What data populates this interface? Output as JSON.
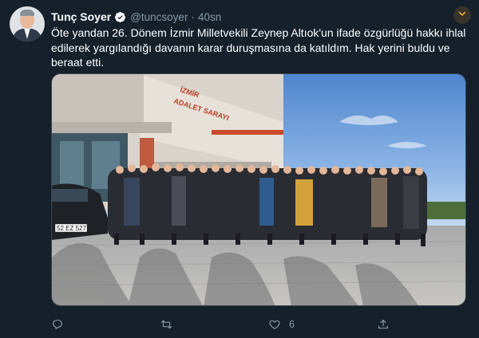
{
  "tweet": {
    "author_name": "Tunç Soyer",
    "handle": "@tuncsoyer",
    "separator": "·",
    "time": "40sn",
    "text": "Öte yandan 26. Dönem İzmir Milletvekili Zeynep Altıok'un ifade özgürlüğü hakkı ihlal edilerek yargılandığı davanın karar duruşmasına da katıldım. Hak yerini buldu ve beraat etti.",
    "image": {
      "building_sign": "İZMİR\nADALET SARAYI",
      "license_plate": "52 EZ 527"
    },
    "actions": {
      "reply_count": "",
      "retweet_count": "",
      "like_count": "6",
      "share_count": ""
    }
  },
  "icons": {
    "verified": "verified-badge-icon",
    "caret": "chevron-down-icon",
    "reply": "reply-icon",
    "retweet": "retweet-icon",
    "like": "heart-icon",
    "share": "share-icon"
  },
  "colors": {
    "background": "#15202b",
    "secondary_text": "#8899a6",
    "accent": "#1da1f2",
    "caret_bg": "#37352b",
    "caret_fg": "#ffad1f"
  }
}
